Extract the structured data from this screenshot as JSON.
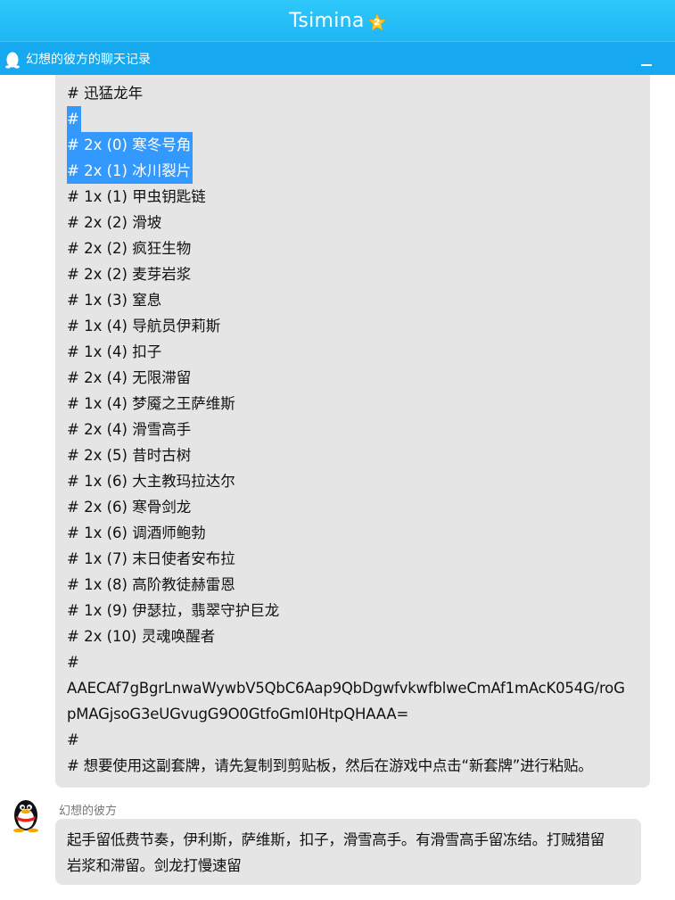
{
  "window": {
    "title": "Tsimina",
    "badge": "2",
    "chat_title": "幻想的彼方的聊天记录"
  },
  "message1": {
    "lines": [
      "# 迅猛龙年",
      "#",
      "# 2x (0) 寒冬号角",
      "# 2x (1) 冰川裂片",
      "# 1x (1) 甲虫钥匙链",
      "# 2x (2) 滑坡",
      "# 2x (2) 疯狂生物",
      "# 2x (2) 麦芽岩浆",
      "# 1x (3) 窒息",
      "# 1x (4) 导航员伊莉斯",
      "# 1x (4) 扣子",
      "# 2x (4) 无限滞留",
      "# 1x (4) 梦魇之王萨维斯",
      "# 2x (4) 滑雪高手",
      "# 2x (5) 昔时古树",
      "# 1x (6) 大主教玛拉达尔",
      "# 2x (6) 寒骨剑龙",
      "# 1x (6) 调酒师鲍勃",
      "# 1x (7) 末日使者安布拉",
      "# 1x (8) 高阶教徒赫雷恩",
      "# 1x (9) 伊瑟拉，翡翠守护巨龙",
      "# 2x (10) 灵魂唤醒者",
      "#",
      "AAECAf7gBgrLnwaWywbV5QbC6Aap9QbDgwfvkwfblweCmAf1mAcK054G/roG",
      "pMAGjsoG3eUGvugG9O0GtfoGmI0HtpQHAAA=",
      "#",
      "# 想要使用这副套牌，请先复制到剪贴板，然后在游戏中点击“新套牌”进行粘贴。"
    ]
  },
  "message2": {
    "sender": "幻想的彼方",
    "lines": [
      "起手留低费节奏，伊利斯，萨维斯，扣子，滑雪高手。有滑雪高手留冻结。打贼猎留",
      "岩浆和滞留。剑龙打慢速留"
    ]
  },
  "colors": {
    "titlebar": "#22bdf7",
    "subbar": "#16a9ef",
    "bubble": "#e5e5e5",
    "selection": "#3399ff"
  }
}
